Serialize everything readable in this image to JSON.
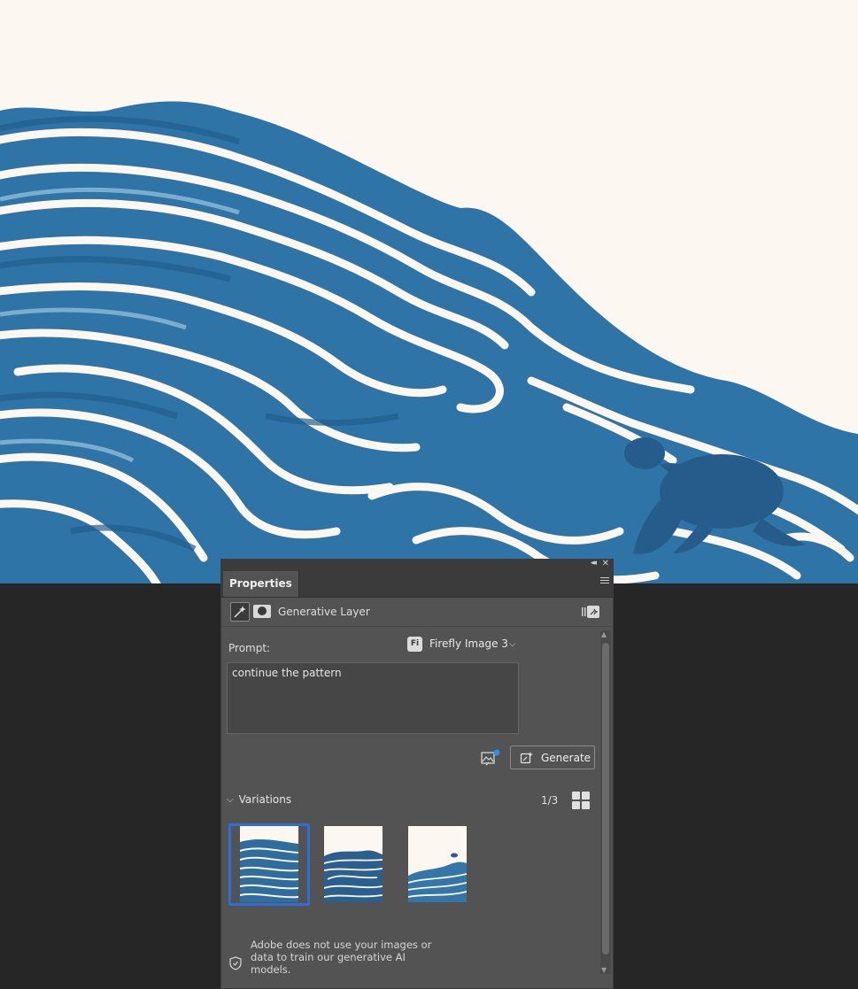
{
  "canvas": {
    "background": "#fdf7f1",
    "artwork": "watercolor-wave-pattern-with-sea-turtle",
    "wave_colors": [
      "#1f5f8f",
      "#2f74a6",
      "#4a8cb9",
      "#8fbcd8"
    ]
  },
  "panel": {
    "tab_label": "Properties",
    "collapse_icon": "double-chevron-left-icon",
    "close_icon": "close-icon",
    "menu_icon": "hamburger-menu-icon",
    "layer_type": "Generative Layer",
    "prompt_label": "Prompt:",
    "model": {
      "badge": "Fi",
      "name": "Firefly Image 3",
      "chevron": "⌵"
    },
    "prompt_value": "continue the pattern",
    "generate_label": "Generate",
    "variations_label": "Variations",
    "variation_count": "1/3",
    "selected_variation": 1,
    "disclaimer": "Adobe does not use your images or data to train our generative AI models."
  },
  "colors": {
    "panel_bg": "#535353",
    "panel_header": "#3b3b3b",
    "app_bg": "#262626",
    "selection_accent": "#2d6fd6",
    "notify_dot": "#2e8df5"
  }
}
